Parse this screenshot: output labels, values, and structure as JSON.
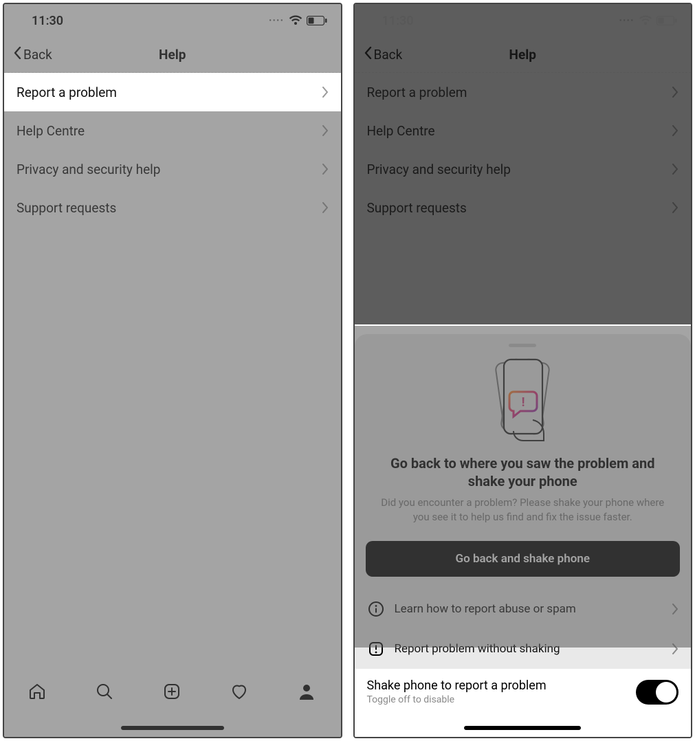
{
  "left": {
    "status": {
      "time": "11:30"
    },
    "nav": {
      "back": "Back",
      "title": "Help"
    },
    "rows": {
      "r0": "Report a problem",
      "r1": "Help Centre",
      "r2": "Privacy and security help",
      "r3": "Support requests"
    }
  },
  "right": {
    "status": {
      "time": "11:30"
    },
    "nav": {
      "back": "Back",
      "title": "Help"
    },
    "rows": {
      "r0": "Report a problem",
      "r1": "Help Centre",
      "r2": "Privacy and security help",
      "r3": "Support requests"
    },
    "sheet": {
      "heading": "Go back to where you saw the problem and shake your phone",
      "sub": "Did you encounter a problem? Please shake your phone where you see it to help us find and fix the issue faster.",
      "primary": "Go back and shake phone",
      "opt1": "Learn how to report abuse or spam",
      "opt2": "Report problem without shaking",
      "toggle": {
        "title": "Shake phone to report a problem",
        "sub": "Toggle off to disable"
      }
    }
  }
}
